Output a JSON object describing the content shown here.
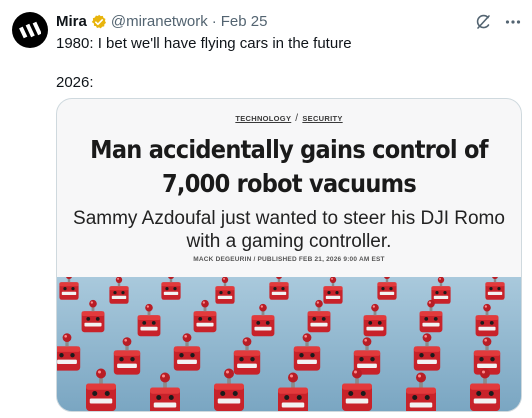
{
  "author": {
    "name": "Mira",
    "handle": "@miranetwork",
    "separator": "·",
    "date": "Feb 25"
  },
  "tweet": {
    "line1": "1980: I bet we'll have flying cars in the future",
    "line2": "2026:"
  },
  "card": {
    "category": "TECHNOLOGY",
    "separator": "/",
    "subcategory": "SECURITY",
    "headline": "Man accidentally gains control of 7,000 robot vacuums",
    "subheadline": "Sammy Azdoufal just wanted to steer his DJI Romo with a gaming controller.",
    "byline": "MACK DEGEURIN / PUBLISHED FEB 21, 2026 9:00 AM EST"
  },
  "icons": {
    "avatar": "mira-logo-icon",
    "badge": "verified-gold-badge-icon",
    "grok": "grok-icon",
    "more": "more-horizontal-icon"
  },
  "colors": {
    "text": "#0f1419",
    "secondary": "#536471",
    "badge": "#e8b40c",
    "robot_red": "#d4282b",
    "photo_bg": "#8fb7cf"
  }
}
